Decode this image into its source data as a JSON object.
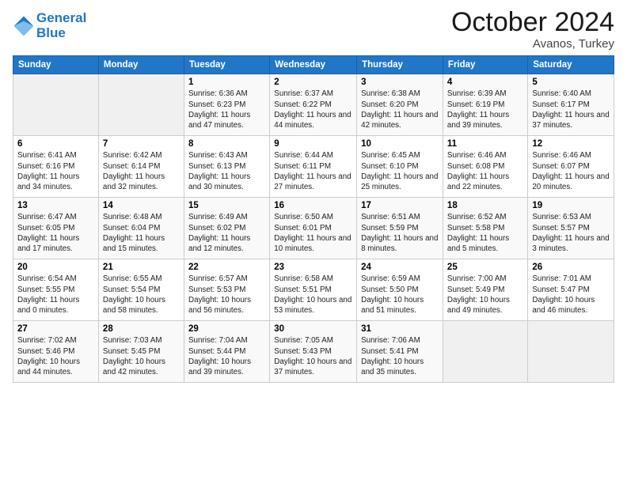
{
  "header": {
    "logo_line1": "General",
    "logo_line2": "Blue",
    "month": "October 2024",
    "location": "Avanos, Turkey"
  },
  "days_of_week": [
    "Sunday",
    "Monday",
    "Tuesday",
    "Wednesday",
    "Thursday",
    "Friday",
    "Saturday"
  ],
  "weeks": [
    [
      {
        "day": null
      },
      {
        "day": null
      },
      {
        "day": "1",
        "sunrise": "Sunrise: 6:36 AM",
        "sunset": "Sunset: 6:23 PM",
        "daylight": "Daylight: 11 hours and 47 minutes."
      },
      {
        "day": "2",
        "sunrise": "Sunrise: 6:37 AM",
        "sunset": "Sunset: 6:22 PM",
        "daylight": "Daylight: 11 hours and 44 minutes."
      },
      {
        "day": "3",
        "sunrise": "Sunrise: 6:38 AM",
        "sunset": "Sunset: 6:20 PM",
        "daylight": "Daylight: 11 hours and 42 minutes."
      },
      {
        "day": "4",
        "sunrise": "Sunrise: 6:39 AM",
        "sunset": "Sunset: 6:19 PM",
        "daylight": "Daylight: 11 hours and 39 minutes."
      },
      {
        "day": "5",
        "sunrise": "Sunrise: 6:40 AM",
        "sunset": "Sunset: 6:17 PM",
        "daylight": "Daylight: 11 hours and 37 minutes."
      }
    ],
    [
      {
        "day": "6",
        "sunrise": "Sunrise: 6:41 AM",
        "sunset": "Sunset: 6:16 PM",
        "daylight": "Daylight: 11 hours and 34 minutes."
      },
      {
        "day": "7",
        "sunrise": "Sunrise: 6:42 AM",
        "sunset": "Sunset: 6:14 PM",
        "daylight": "Daylight: 11 hours and 32 minutes."
      },
      {
        "day": "8",
        "sunrise": "Sunrise: 6:43 AM",
        "sunset": "Sunset: 6:13 PM",
        "daylight": "Daylight: 11 hours and 30 minutes."
      },
      {
        "day": "9",
        "sunrise": "Sunrise: 6:44 AM",
        "sunset": "Sunset: 6:11 PM",
        "daylight": "Daylight: 11 hours and 27 minutes."
      },
      {
        "day": "10",
        "sunrise": "Sunrise: 6:45 AM",
        "sunset": "Sunset: 6:10 PM",
        "daylight": "Daylight: 11 hours and 25 minutes."
      },
      {
        "day": "11",
        "sunrise": "Sunrise: 6:46 AM",
        "sunset": "Sunset: 6:08 PM",
        "daylight": "Daylight: 11 hours and 22 minutes."
      },
      {
        "day": "12",
        "sunrise": "Sunrise: 6:46 AM",
        "sunset": "Sunset: 6:07 PM",
        "daylight": "Daylight: 11 hours and 20 minutes."
      }
    ],
    [
      {
        "day": "13",
        "sunrise": "Sunrise: 6:47 AM",
        "sunset": "Sunset: 6:05 PM",
        "daylight": "Daylight: 11 hours and 17 minutes."
      },
      {
        "day": "14",
        "sunrise": "Sunrise: 6:48 AM",
        "sunset": "Sunset: 6:04 PM",
        "daylight": "Daylight: 11 hours and 15 minutes."
      },
      {
        "day": "15",
        "sunrise": "Sunrise: 6:49 AM",
        "sunset": "Sunset: 6:02 PM",
        "daylight": "Daylight: 11 hours and 12 minutes."
      },
      {
        "day": "16",
        "sunrise": "Sunrise: 6:50 AM",
        "sunset": "Sunset: 6:01 PM",
        "daylight": "Daylight: 11 hours and 10 minutes."
      },
      {
        "day": "17",
        "sunrise": "Sunrise: 6:51 AM",
        "sunset": "Sunset: 5:59 PM",
        "daylight": "Daylight: 11 hours and 8 minutes."
      },
      {
        "day": "18",
        "sunrise": "Sunrise: 6:52 AM",
        "sunset": "Sunset: 5:58 PM",
        "daylight": "Daylight: 11 hours and 5 minutes."
      },
      {
        "day": "19",
        "sunrise": "Sunrise: 6:53 AM",
        "sunset": "Sunset: 5:57 PM",
        "daylight": "Daylight: 11 hours and 3 minutes."
      }
    ],
    [
      {
        "day": "20",
        "sunrise": "Sunrise: 6:54 AM",
        "sunset": "Sunset: 5:55 PM",
        "daylight": "Daylight: 11 hours and 0 minutes."
      },
      {
        "day": "21",
        "sunrise": "Sunrise: 6:55 AM",
        "sunset": "Sunset: 5:54 PM",
        "daylight": "Daylight: 10 hours and 58 minutes."
      },
      {
        "day": "22",
        "sunrise": "Sunrise: 6:57 AM",
        "sunset": "Sunset: 5:53 PM",
        "daylight": "Daylight: 10 hours and 56 minutes."
      },
      {
        "day": "23",
        "sunrise": "Sunrise: 6:58 AM",
        "sunset": "Sunset: 5:51 PM",
        "daylight": "Daylight: 10 hours and 53 minutes."
      },
      {
        "day": "24",
        "sunrise": "Sunrise: 6:59 AM",
        "sunset": "Sunset: 5:50 PM",
        "daylight": "Daylight: 10 hours and 51 minutes."
      },
      {
        "day": "25",
        "sunrise": "Sunrise: 7:00 AM",
        "sunset": "Sunset: 5:49 PM",
        "daylight": "Daylight: 10 hours and 49 minutes."
      },
      {
        "day": "26",
        "sunrise": "Sunrise: 7:01 AM",
        "sunset": "Sunset: 5:47 PM",
        "daylight": "Daylight: 10 hours and 46 minutes."
      }
    ],
    [
      {
        "day": "27",
        "sunrise": "Sunrise: 7:02 AM",
        "sunset": "Sunset: 5:46 PM",
        "daylight": "Daylight: 10 hours and 44 minutes."
      },
      {
        "day": "28",
        "sunrise": "Sunrise: 7:03 AM",
        "sunset": "Sunset: 5:45 PM",
        "daylight": "Daylight: 10 hours and 42 minutes."
      },
      {
        "day": "29",
        "sunrise": "Sunrise: 7:04 AM",
        "sunset": "Sunset: 5:44 PM",
        "daylight": "Daylight: 10 hours and 39 minutes."
      },
      {
        "day": "30",
        "sunrise": "Sunrise: 7:05 AM",
        "sunset": "Sunset: 5:43 PM",
        "daylight": "Daylight: 10 hours and 37 minutes."
      },
      {
        "day": "31",
        "sunrise": "Sunrise: 7:06 AM",
        "sunset": "Sunset: 5:41 PM",
        "daylight": "Daylight: 10 hours and 35 minutes."
      },
      {
        "day": null
      },
      {
        "day": null
      }
    ]
  ]
}
